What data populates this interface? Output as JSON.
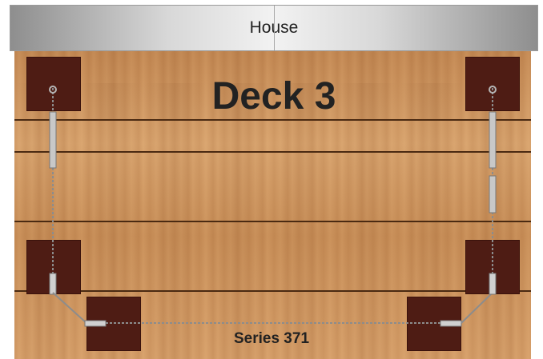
{
  "house": {
    "label": "House"
  },
  "deck": {
    "title": "Deck 3",
    "series_label": "Series 371"
  },
  "colors": {
    "wood": "#c98f58",
    "post": "#4e1c14",
    "cable": "#9a9a9a",
    "house_bar": "#d8d8d8"
  }
}
